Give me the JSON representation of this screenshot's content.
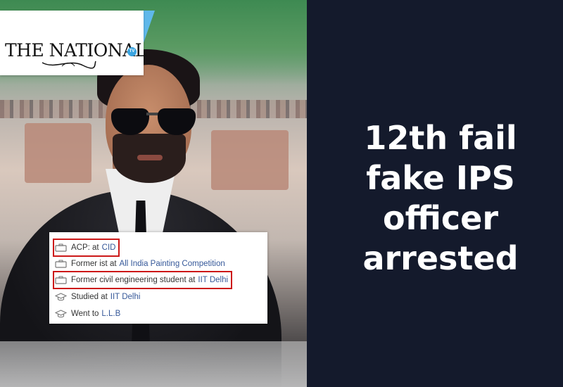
{
  "brand": {
    "name": "THE NATIONAL",
    "badge": "TV",
    "accent_color": "#5fb8ea"
  },
  "profile": {
    "items": [
      {
        "icon": "briefcase-icon",
        "text": "ACP: at",
        "link": "CID",
        "highlighted": true
      },
      {
        "icon": "briefcase-icon",
        "text": "Former ist at",
        "link": "All India Painting Competition",
        "highlighted": false
      },
      {
        "icon": "briefcase-icon",
        "text": "Former civil engineering student at",
        "link": "IIT Delhi",
        "highlighted": true
      },
      {
        "icon": "graduation-cap-icon",
        "text": "Studied at",
        "link": "IIT Delhi",
        "highlighted": false
      },
      {
        "icon": "graduation-cap-icon",
        "text": "Went to",
        "link": "L.L.B",
        "highlighted": false
      }
    ],
    "highlight_color": "#cc1818",
    "link_color": "#365899"
  },
  "headline": {
    "lines": [
      "12th fail",
      "fake IPS",
      "officer",
      "arrested"
    ]
  },
  "colors": {
    "background": "#141a2c",
    "headline_text": "#ffffff"
  }
}
